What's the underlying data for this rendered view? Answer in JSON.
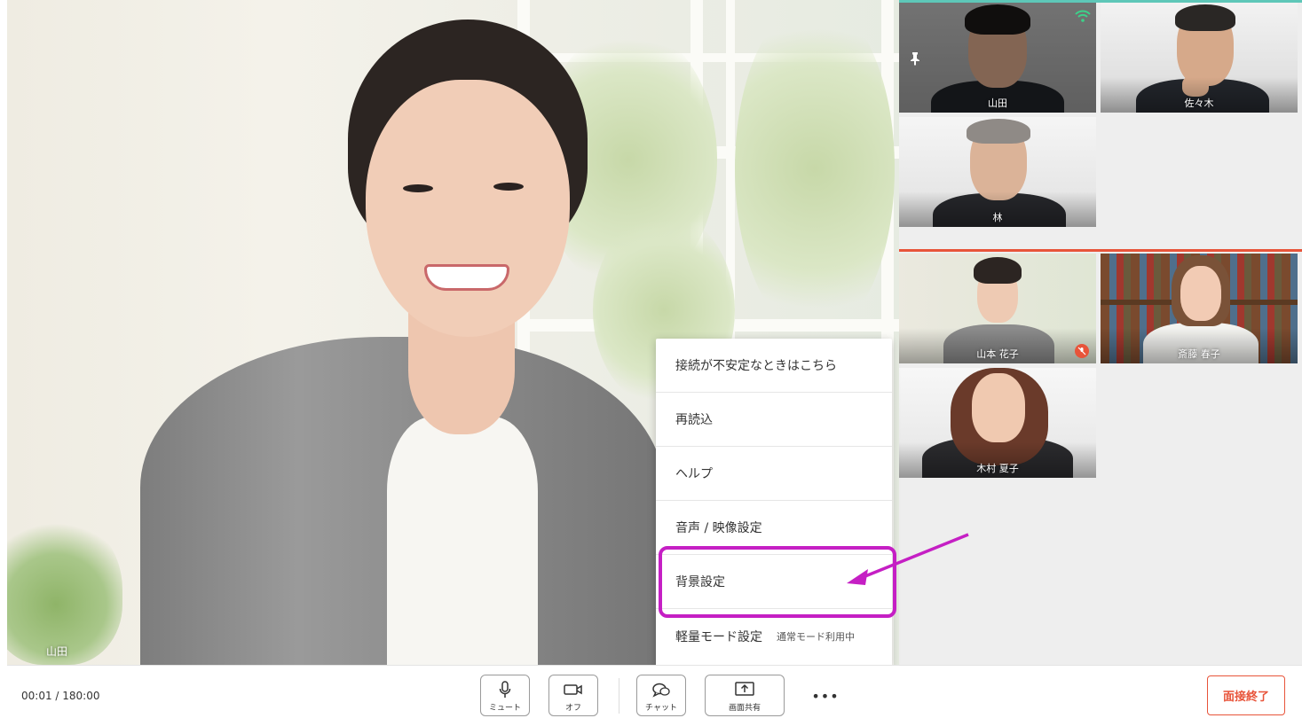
{
  "main_video": {
    "speaker_name": "山田"
  },
  "participants": [
    {
      "name": "山田",
      "pinned": true,
      "signal": true,
      "muted": false
    },
    {
      "name": "佐々木",
      "pinned": false,
      "signal": false,
      "muted": false
    },
    {
      "name": "林",
      "pinned": false,
      "signal": false,
      "muted": false
    },
    {
      "name": "山本 花子",
      "pinned": false,
      "signal": false,
      "muted": true
    },
    {
      "name": "斎藤 春子",
      "pinned": false,
      "signal": false,
      "muted": false
    },
    {
      "name": "木村 夏子",
      "pinned": false,
      "signal": false,
      "muted": false
    }
  ],
  "menu": {
    "items": [
      {
        "label": "接続が不安定なときはこちら"
      },
      {
        "label": "再読込"
      },
      {
        "label": "ヘルプ"
      },
      {
        "label": "音声 / 映像設定"
      },
      {
        "label": "背景設定"
      },
      {
        "label": "軽量モード設定",
        "sub": "通常モード利用中"
      }
    ]
  },
  "toolbar": {
    "timer": "00:01 / 180:00",
    "mute_label": "ミュート",
    "video_off_label": "オフ",
    "chat_label": "チャット",
    "share_label": "画面共有",
    "more_label": "•••",
    "end_label": "面接終了"
  },
  "colors": {
    "accent_teal": "#5ec7b8",
    "active_red": "#e8543a",
    "annotation_magenta": "#c51fc4"
  },
  "icons": {
    "mute": "microphone-icon",
    "video": "camera-icon",
    "chat": "chat-bubble-icon",
    "share": "screen-share-icon",
    "pin": "pin-icon",
    "signal": "wifi-icon",
    "muted_badge": "mic-off-icon"
  }
}
